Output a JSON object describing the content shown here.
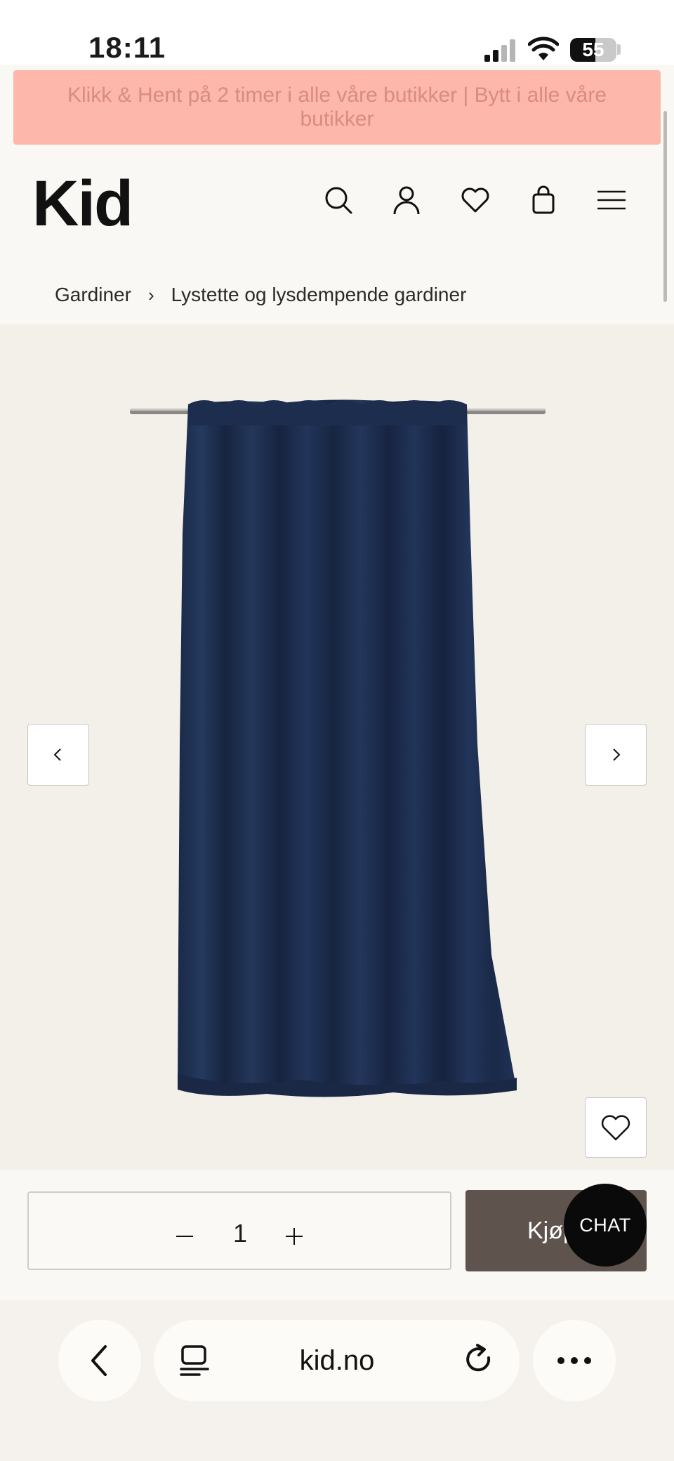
{
  "status_bar": {
    "time": "18:11",
    "battery": "55",
    "battery_level": 0.55
  },
  "promo": {
    "text": "Klikk & Hent på 2 timer i alle våre butikker | Bytt i alle våre butikker"
  },
  "header": {
    "logo": "Kid",
    "icons": [
      "search-icon",
      "user-icon",
      "heart-icon",
      "bag-icon",
      "menu-icon"
    ]
  },
  "breadcrumb": {
    "items": [
      "Gardiner",
      "Lystette og lysdempende gardiner"
    ],
    "separator": "›"
  },
  "product": {
    "image": "navy-curtain",
    "color": "#1e2f4e"
  },
  "purchase": {
    "quantity": "1",
    "buy_label": "Kjøp"
  },
  "chat": {
    "label": "CHAT"
  },
  "browser": {
    "url": "kid.no"
  },
  "colors": {
    "promo_bg": "#fdb7ab",
    "buy_button": "#5e544d",
    "page_bg": "#faf8f4",
    "image_bg": "#f3efe9"
  }
}
